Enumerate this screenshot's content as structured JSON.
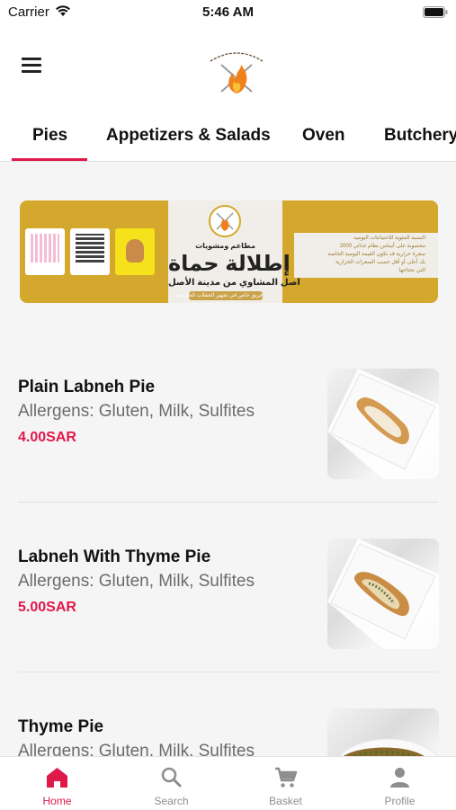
{
  "status_bar": {
    "carrier": "Carrier",
    "time": "5:46 AM"
  },
  "header": {
    "menu_icon": "hamburger-menu-icon",
    "logo": "restaurant-logo"
  },
  "category_tabs": [
    {
      "label": "Pies",
      "selected": true
    },
    {
      "label": "Appetizers & Salads",
      "selected": false
    },
    {
      "label": "Oven",
      "selected": false
    },
    {
      "label": "Butchery",
      "selected": false
    }
  ],
  "banner": {
    "brand_name": "إطلالة حماة",
    "brand_tagline": "مطاعم ومشويات",
    "subtitle": "أصل المشاوي من مدينة الأصل",
    "slogan": "فريق خاص في تجهيز الحفلات الخارجية",
    "notice_lines": [
      "النسبة المئوية للاحتياجات اليومية",
      "محسوبة على أساس نظام غذائي 2000",
      "سعرة حرارية قد تكون القيمة اليومية الخاصة",
      "بك أعلى أو أقل حسب السعرات الحرارية",
      "التي تحتاجها"
    ]
  },
  "menu_items": [
    {
      "name": "Plain Labneh Pie",
      "allergens": "Allergens: Gluten, Milk, Sulfites",
      "price": "4.00SAR"
    },
    {
      "name": "Labneh With Thyme Pie",
      "allergens": "Allergens: Gluten, Milk, Sulfites",
      "price": "5.00SAR"
    },
    {
      "name": "Thyme Pie",
      "allergens": "Allergens: Gluten, Milk, Sulfites",
      "price": ""
    }
  ],
  "bottom_tabs": [
    {
      "label": "Home",
      "icon": "home-icon",
      "active": true
    },
    {
      "label": "Search",
      "icon": "search-icon",
      "active": false
    },
    {
      "label": "Basket",
      "icon": "cart-icon",
      "active": false
    },
    {
      "label": "Profile",
      "icon": "profile-icon",
      "active": false
    }
  ],
  "colors": {
    "accent": "#e0194b",
    "banner_gold": "#d4a82c",
    "inactive": "#8e8e8e"
  }
}
